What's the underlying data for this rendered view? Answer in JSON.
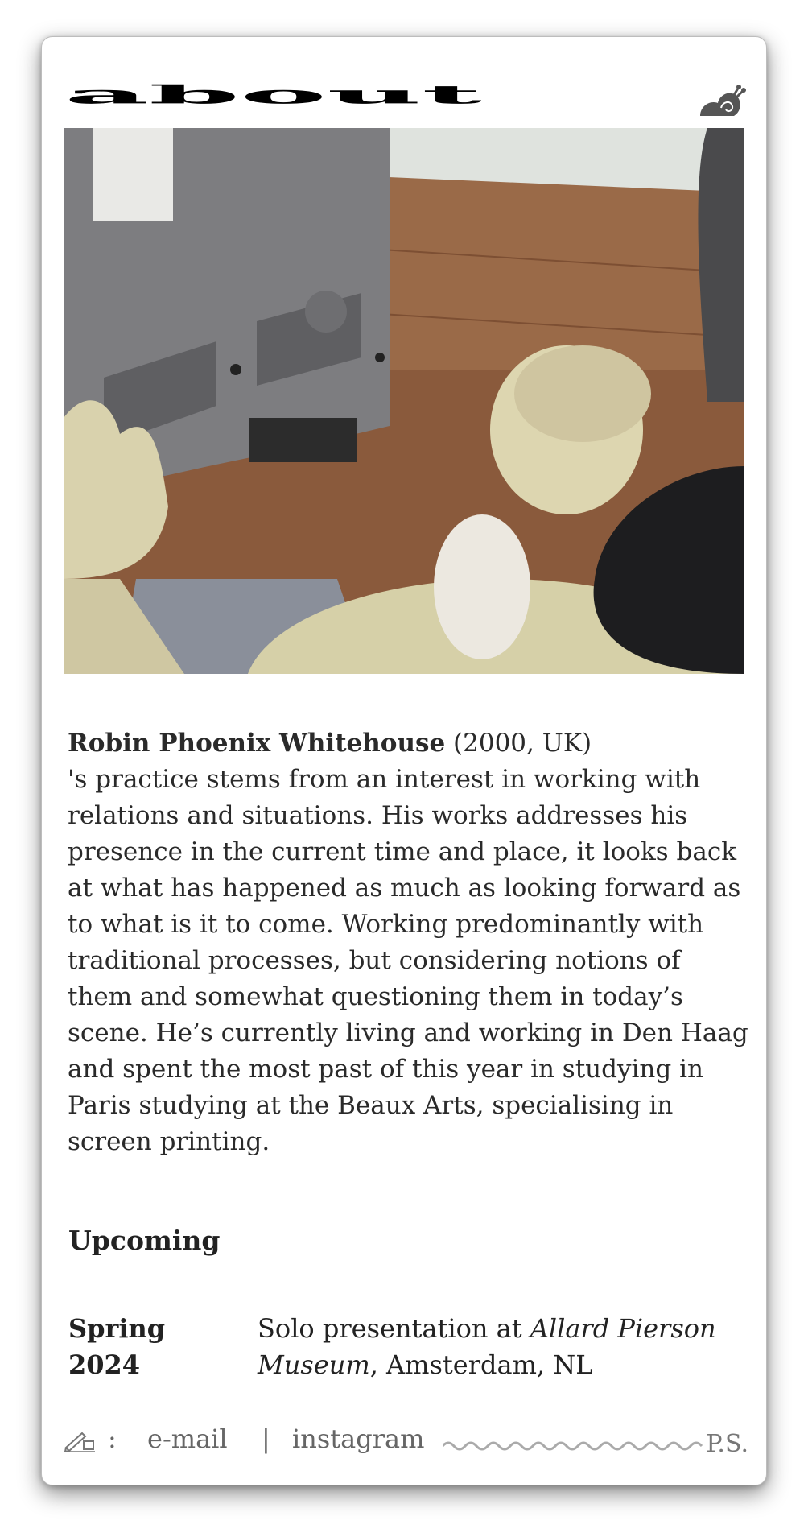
{
  "header": {
    "title": "about",
    "icon": "snail-icon"
  },
  "photo": {
    "icon": "photo-sculpture"
  },
  "bio": {
    "name": "Robin Phoenix Whitehouse",
    "meta": " (2000, UK)",
    "text": "'s practice stems from an interest in working with relations and situations. His works addresses his presence in the current time and place, it looks back at what has happened as much as looking forward as to what is it to come. Working predominantly with traditional processes, but considering notions of them and somewhat questioning them in today’s scene. He’s currently living and working in Den Haag and spent the most past of this year in studying in Paris studying at the Beaux Arts, specialising in screen printing."
  },
  "upcoming": {
    "title": "Upcoming",
    "events": [
      {
        "date": "Spring 2024",
        "desc_pre": "Solo presentation at ",
        "venue": "Allard Pierson Museum",
        "desc_post": ", Amsterdam, NL"
      }
    ]
  },
  "footer": {
    "pen_icon": "pen-icon",
    "colon": ":",
    "email": "e-mail",
    "separator": "|",
    "instagram": "instagram",
    "ps": "P.S."
  }
}
